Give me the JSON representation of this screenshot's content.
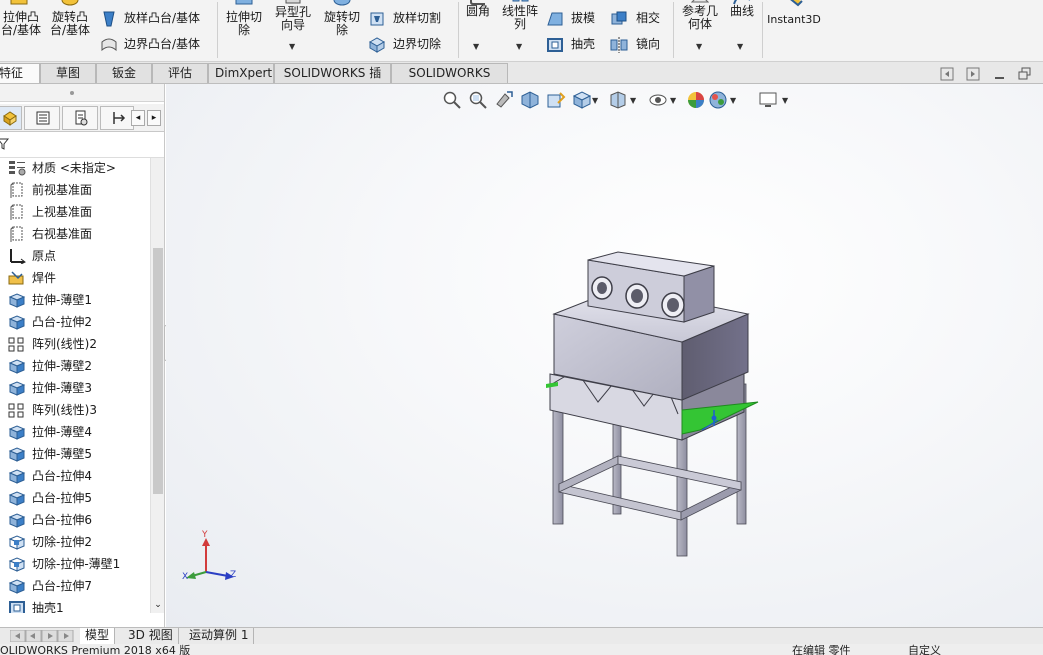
{
  "ribbon": {
    "extrude_boss": "拉伸凸\n台/基体",
    "revolve_boss": "旋转凸\n台/基体",
    "loft_boss": "放样凸台/基体",
    "boundary_boss": "边界凸台/基体",
    "extrude_cut": "拉伸切\n除",
    "hole_wizard": "异型孔\n向导",
    "revolve_cut": "旋转切\n除",
    "loft_cut": "放样切割",
    "boundary_cut": "边界切除",
    "fillet": "圆角",
    "linear_pattern": "线性阵\n列",
    "draft": "拔模",
    "intersect": "相交",
    "shell": "抽壳",
    "mirror": "镜向",
    "ref_geometry": "参考几\n何体",
    "curves": "曲线",
    "instant3d": "Instant3D"
  },
  "tabs": [
    "特征",
    "草图",
    "钣金",
    "评估",
    "DimXpert",
    "SOLIDWORKS 插件",
    "SOLIDWORKS MBD"
  ],
  "active_tab": "特征",
  "tree": [
    {
      "label": "材质 <未指定>",
      "icon": "material-icon"
    },
    {
      "label": "前视基准面",
      "icon": "plane-icon"
    },
    {
      "label": "上视基准面",
      "icon": "plane-icon"
    },
    {
      "label": "右视基准面",
      "icon": "plane-icon"
    },
    {
      "label": "原点",
      "icon": "origin-icon"
    },
    {
      "label": "焊件",
      "icon": "weldment-icon"
    },
    {
      "label": "拉伸-薄壁1",
      "icon": "extrude-icon"
    },
    {
      "label": "凸台-拉伸2",
      "icon": "extrude-icon"
    },
    {
      "label": "阵列(线性)2",
      "icon": "linear-pattern-icon"
    },
    {
      "label": "拉伸-薄壁2",
      "icon": "extrude-icon"
    },
    {
      "label": "拉伸-薄壁3",
      "icon": "extrude-icon"
    },
    {
      "label": "阵列(线性)3",
      "icon": "linear-pattern-icon"
    },
    {
      "label": "拉伸-薄壁4",
      "icon": "extrude-icon"
    },
    {
      "label": "拉伸-薄壁5",
      "icon": "extrude-icon"
    },
    {
      "label": "凸台-拉伸4",
      "icon": "extrude-icon"
    },
    {
      "label": "凸台-拉伸5",
      "icon": "extrude-icon"
    },
    {
      "label": "凸台-拉伸6",
      "icon": "extrude-icon"
    },
    {
      "label": "切除-拉伸2",
      "icon": "cut-extrude-icon"
    },
    {
      "label": "切除-拉伸-薄壁1",
      "icon": "cut-extrude-icon"
    },
    {
      "label": "凸台-拉伸7",
      "icon": "extrude-icon"
    },
    {
      "label": "抽壳1",
      "icon": "shell-icon"
    }
  ],
  "bottom_tabs": [
    "模型",
    "3D 视图",
    "运动算例 1"
  ],
  "active_bottom_tab": "模型",
  "status": {
    "left": "OLIDWORKS Premium 2018 x64 版",
    "editing": "在编辑 零件",
    "custom": "自定义"
  },
  "axes": {
    "x": "X",
    "y": "Y",
    "z": "Z"
  },
  "colors": {
    "accent_blue": "#2f6fb3",
    "model_body": "#c4c4d4",
    "highlight_green": "#34c534"
  }
}
